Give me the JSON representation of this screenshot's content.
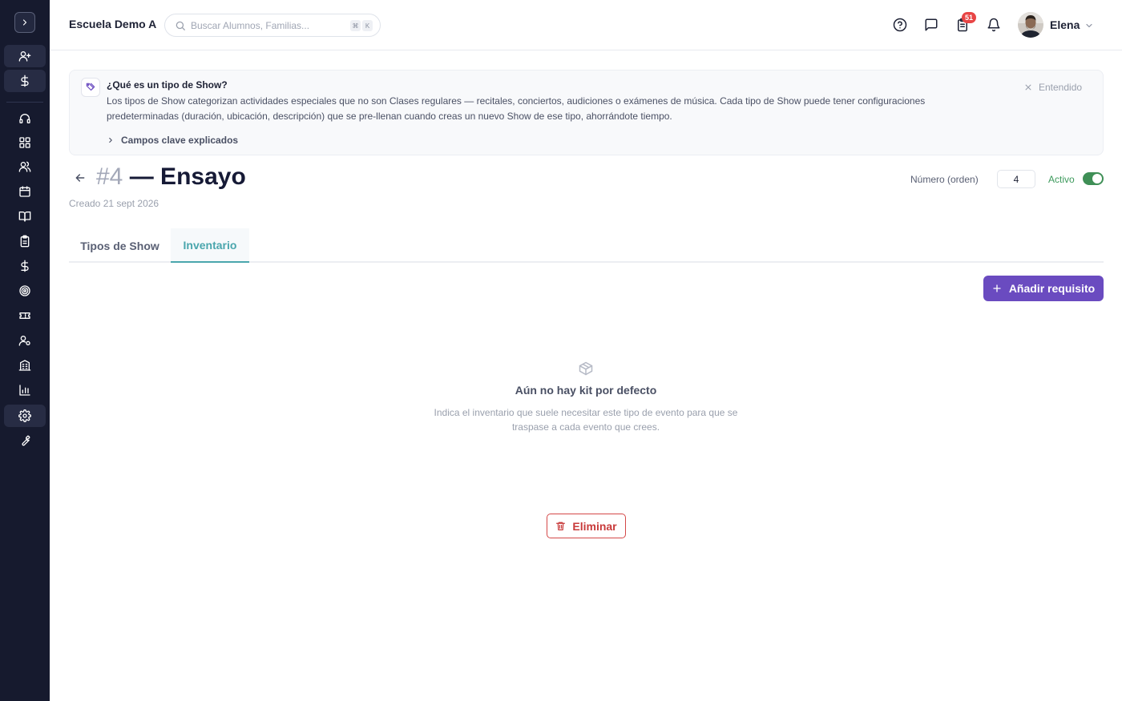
{
  "sidebar": {
    "toggle_icon": "chevron-right-icon",
    "items": [
      {
        "icon": "user-plus-icon",
        "highlighted": true
      },
      {
        "icon": "dollar-icon",
        "highlighted": true
      },
      {
        "icon": "headset-icon",
        "highlighted": false
      },
      {
        "icon": "dashboard-icon",
        "highlighted": false
      },
      {
        "icon": "users-icon",
        "highlighted": false
      },
      {
        "icon": "calendar-icon",
        "highlighted": false
      },
      {
        "icon": "book-icon",
        "highlighted": false
      },
      {
        "icon": "clipboard-icon",
        "highlighted": false
      },
      {
        "icon": "dollar-icon",
        "highlighted": false
      },
      {
        "icon": "target-icon",
        "highlighted": false
      },
      {
        "icon": "ticket-icon",
        "highlighted": false
      },
      {
        "icon": "user-settings-icon",
        "highlighted": false
      },
      {
        "icon": "building-icon",
        "highlighted": false
      },
      {
        "icon": "bar-chart-icon",
        "highlighted": false
      },
      {
        "icon": "gear-icon",
        "highlighted": true
      },
      {
        "icon": "wrench-icon",
        "highlighted": false
      }
    ]
  },
  "header": {
    "school_name": "Escuela Demo A",
    "search_placeholder": "Buscar Alumnos, Familias...",
    "shortcut_keys": [
      "⌘",
      "K"
    ],
    "task_badge": "51",
    "user_name": "Elena"
  },
  "banner": {
    "title": "¿Qué es un tipo de Show?",
    "text": "Los tipos de Show categorizan actividades especiales que no son Clases regulares — recitales, conciertos, audiciones o exámenes de música. Cada tipo de Show puede tener configuraciones predeterminadas (duración, ubicación, descripción) que se pre-llenan cuando creas un nuevo Show de ese tipo, ahorrándote tiempo.",
    "expand_label": "Campos clave explicados",
    "dismiss_label": "Entendido"
  },
  "page": {
    "number": "#4",
    "title": "— Ensayo",
    "created": "Creado 21 sept 2026",
    "order_label": "Número (orden)",
    "order_value": "4",
    "active_label": "Activo",
    "active": true
  },
  "tabs": [
    {
      "label": "Tipos de Show",
      "active": false
    },
    {
      "label": "Inventario",
      "active": true
    }
  ],
  "actions": {
    "add_label": "Añadir requisito",
    "delete_label": "Eliminar"
  },
  "empty_state": {
    "title": "Aún no hay kit por defecto",
    "text": "Indica el inventario que suele necesitar este tipo de evento para que se traspase a cada evento que crees."
  },
  "colors": {
    "sidebar_bg": "#161a2e",
    "accent_purple": "#6a4bc0",
    "accent_teal": "#4aa6ad",
    "active_green": "#3f8f56",
    "danger_red": "#c83a3a",
    "badge_red": "#e84545"
  }
}
